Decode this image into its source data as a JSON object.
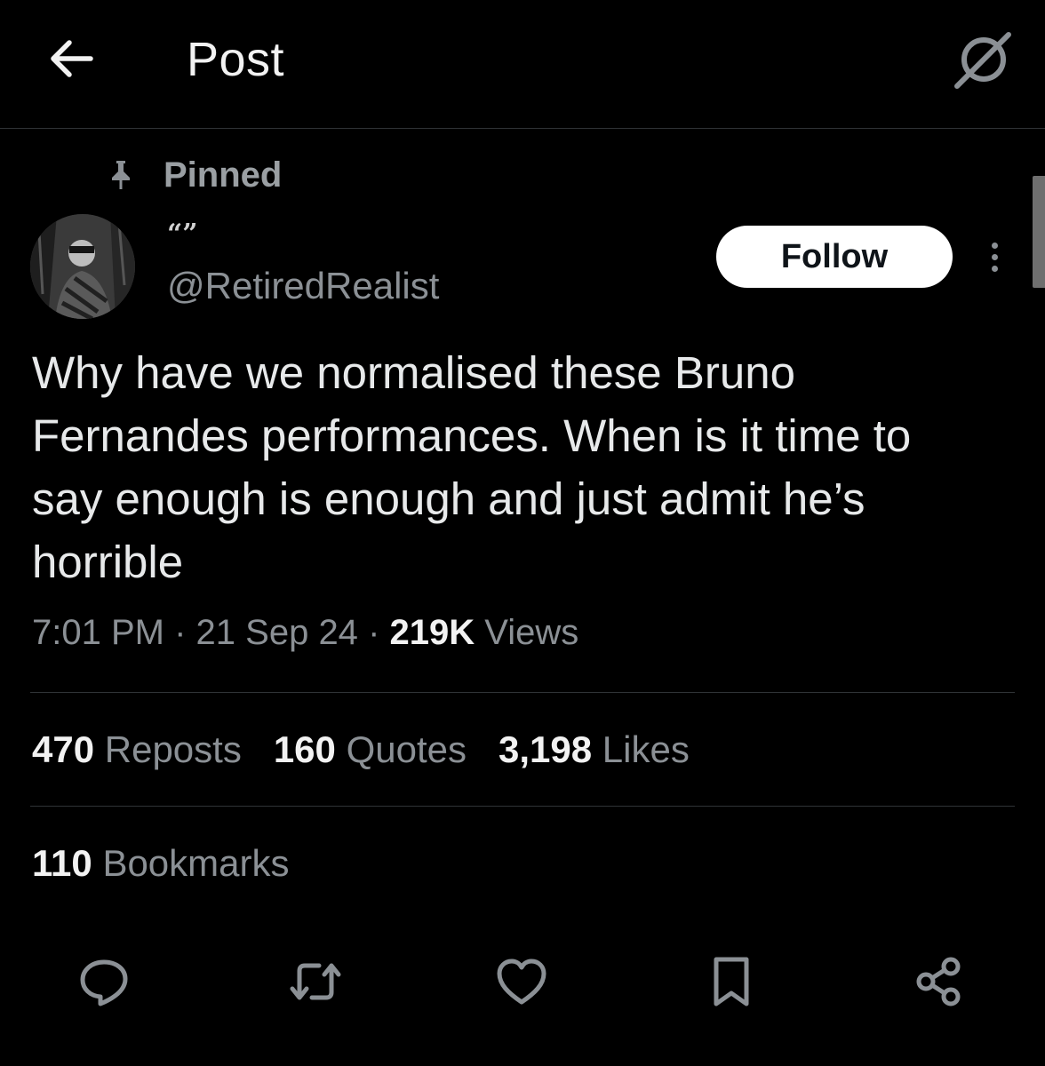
{
  "header": {
    "title": "Post",
    "back_icon": "arrow-left-icon",
    "grok_icon": "grok-icon"
  },
  "post": {
    "pinned_label": "Pinned",
    "display_name": "“”",
    "handle": "@RetiredRealist",
    "follow_label": "Follow",
    "text": "Why have we normalised these Bruno\nFernandes performances. When is it time to\nsay enough is enough and just admit he’s\nhorrible",
    "time": "7:01 PM",
    "date": "21 Sep 24",
    "separator": "·",
    "views_count": "219K",
    "views_label": "Views"
  },
  "stats": {
    "reposts_count": "470",
    "reposts_label": "Reposts",
    "quotes_count": "160",
    "quotes_label": "Quotes",
    "likes_count": "3,198",
    "likes_label": "Likes",
    "bookmarks_count": "110",
    "bookmarks_label": "Bookmarks"
  },
  "actions": [
    "reply-icon",
    "repost-icon",
    "like-icon",
    "bookmark-icon",
    "share-icon"
  ],
  "colors": {
    "background": "#000000",
    "text_primary": "#e7e9ea",
    "text_secondary": "#8b9095",
    "divider": "#2f3336",
    "follow_bg": "#ffffff"
  }
}
